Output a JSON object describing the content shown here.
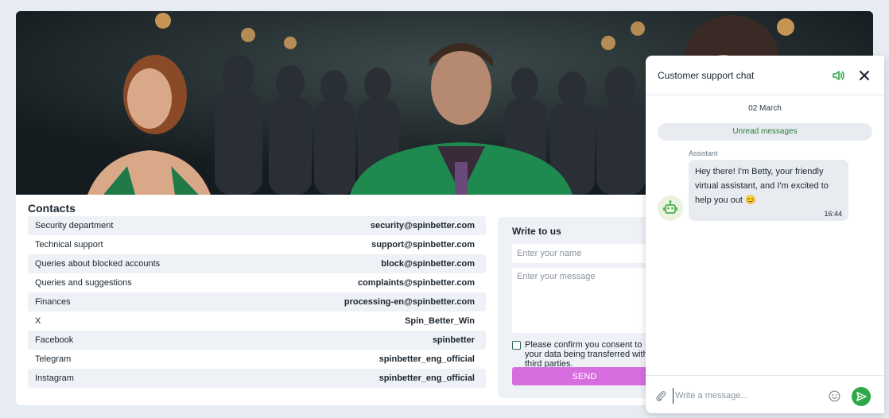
{
  "contacts": {
    "title": "Contacts",
    "rows": [
      {
        "label": "Security department",
        "value": "security@spinbetter.com"
      },
      {
        "label": "Technical support",
        "value": "support@spinbetter.com"
      },
      {
        "label": "Queries about blocked accounts",
        "value": "block@spinbetter.com"
      },
      {
        "label": "Queries and suggestions",
        "value": "complaints@spinbetter.com"
      },
      {
        "label": "Finances",
        "value": "processing-en@spinbetter.com"
      },
      {
        "label": "X",
        "value": "Spin_Better_Win"
      },
      {
        "label": "Facebook",
        "value": "spinbetter"
      },
      {
        "label": "Telegram",
        "value": "spinbetter_eng_official"
      },
      {
        "label": "Instagram",
        "value": "spinbetter_eng_official"
      }
    ]
  },
  "write_form": {
    "title": "Write to us",
    "name_placeholder": "Enter your name",
    "message_placeholder": "Enter your message",
    "consent_text": "Please confirm you consent to your data being transferred with third parties.",
    "send_label": "SEND"
  },
  "chat": {
    "title": "Customer support chat",
    "date": "02 March",
    "unread_label": "Unread messages",
    "sender": "Assistant",
    "message": "Hey there! I'm Betty, your friendly virtual assistant, and I'm excited to help you out 😊",
    "time": "16:44",
    "input_placeholder": "Write a message..."
  },
  "colors": {
    "accent_green": "#2da84a",
    "send_button": "#d66ee0"
  }
}
